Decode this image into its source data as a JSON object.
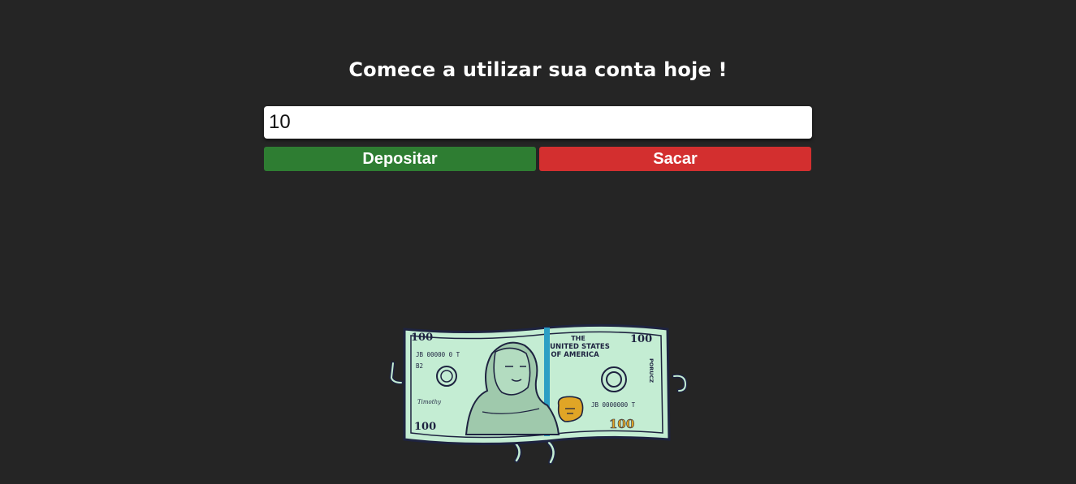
{
  "header": {
    "title": "Comece a utilizar sua conta hoje !"
  },
  "form": {
    "amount_value": "10"
  },
  "actions": {
    "deposit_label": "Depositar",
    "withdraw_label": "Sacar"
  },
  "colors": {
    "background": "#252525",
    "deposit": "#2e7d32",
    "withdraw": "#d32f2f",
    "bill_green": "#c4edd3",
    "bill_outline": "#1e2340"
  },
  "illustration": {
    "serial_top": "JB 00000 0 T",
    "serial_bottom": "JB 0000000 T",
    "denomination": "100",
    "country_line1": "THE",
    "country_line2": "UNITED STATES",
    "country_line3": "OF AMERICA",
    "sign_left": "Timothy",
    "plate": "B2",
    "side_text": "PORUCZ"
  }
}
